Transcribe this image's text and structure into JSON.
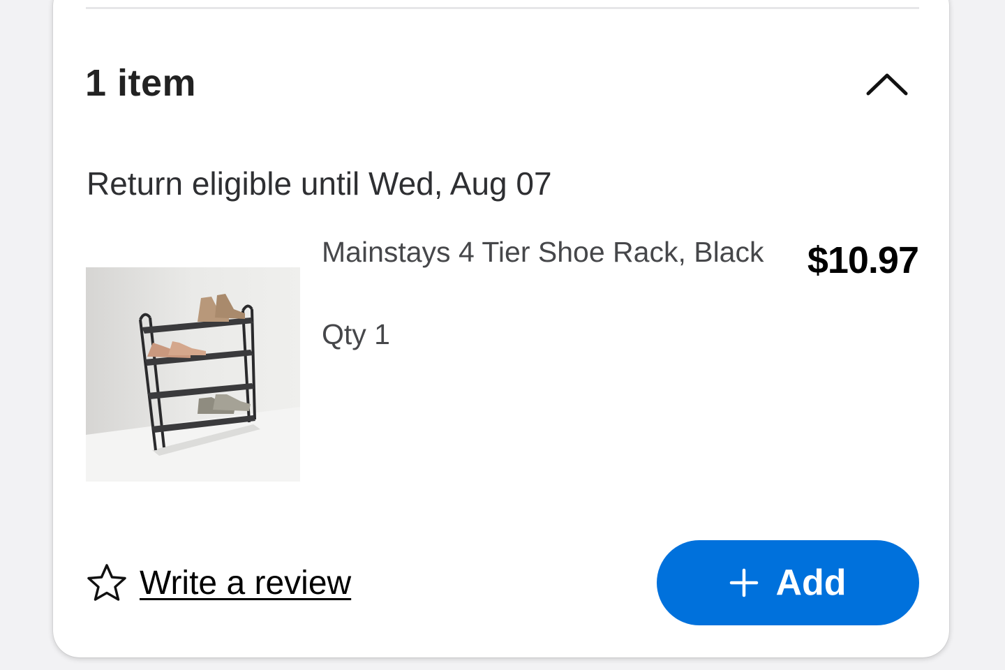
{
  "order_items": {
    "count_label": "1 item",
    "collapse_icon": "chevron-up-icon",
    "return_text": "Return eligible until Wed, Aug 07"
  },
  "product": {
    "name": "Mainstays 4 Tier Shoe Rack, Black",
    "price": "$10.97",
    "qty": "Qty 1",
    "image_icon": "shoe-rack-image"
  },
  "actions": {
    "review_icon": "star-outline-icon",
    "review_label": "Write a review",
    "add_icon": "plus-icon",
    "add_label": "Add"
  },
  "colors": {
    "accent": "#0071dc",
    "text_dark": "#2e2f32",
    "text_muted": "#46474a"
  }
}
